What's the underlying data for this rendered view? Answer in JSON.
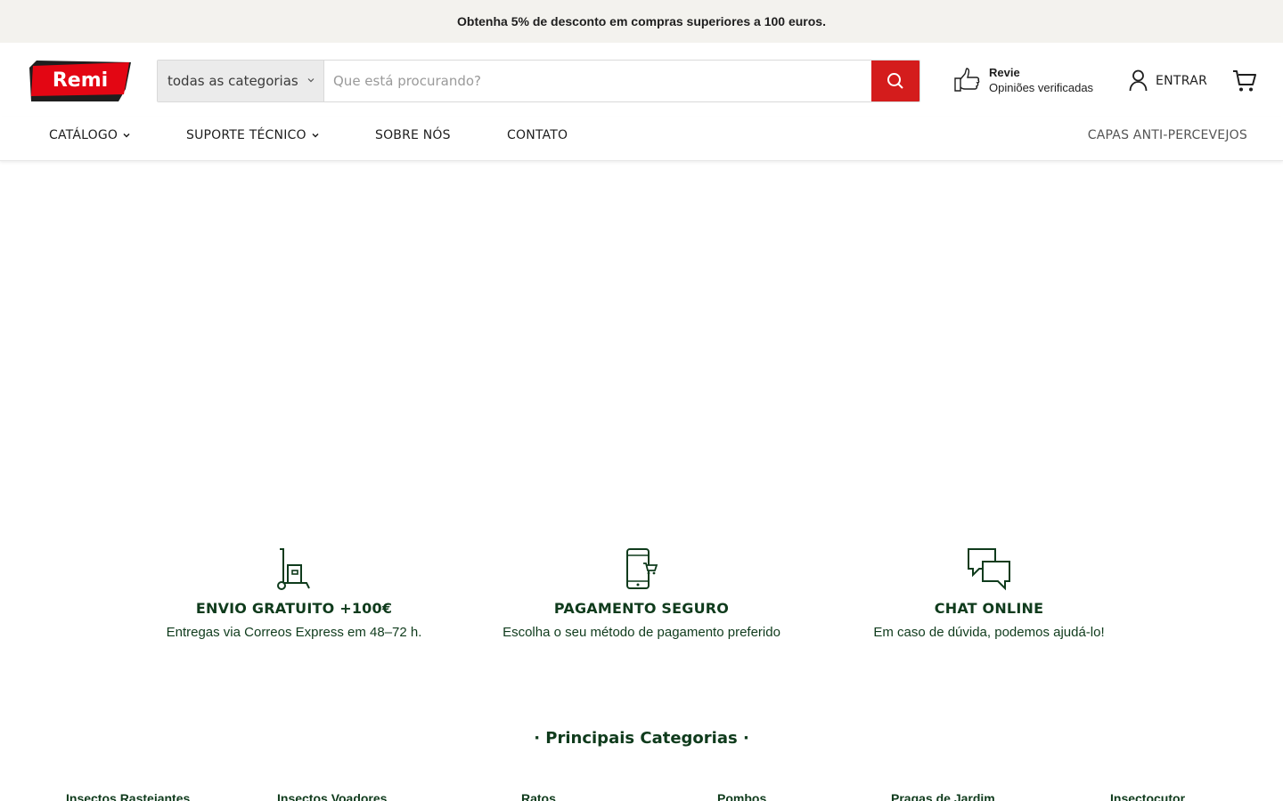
{
  "announcement": "Obtenha 5% de desconto em compras superiores a 100 euros.",
  "logo": {
    "text": "Remi",
    "color": "#e30613"
  },
  "search": {
    "category": "todas as categorias",
    "placeholder": "Que está procurando?",
    "button_color": "#d41c1c"
  },
  "reviews": {
    "title": "Revie",
    "subtitle": "Opiniões verificadas"
  },
  "account": {
    "login_label": "ENTRAR"
  },
  "nav": {
    "items": [
      {
        "label": "CATÁLOGO",
        "has_dropdown": true
      },
      {
        "label": "SUPORTE TÉCNICO",
        "has_dropdown": true
      },
      {
        "label": "SOBRE NÓS",
        "has_dropdown": false
      },
      {
        "label": "CONTATO",
        "has_dropdown": false
      }
    ],
    "right_link": "CAPAS ANTI-PERCEVEJOS"
  },
  "features": [
    {
      "icon": "delivery-trolley-icon",
      "title": "ENVIO GRATUITO +100€",
      "description": "Entregas via Correos Express em 48–72 h."
    },
    {
      "icon": "mobile-payment-icon",
      "title": "PAGAMENTO SEGURO",
      "description": "Escolha o seu método de pagamento preferido"
    },
    {
      "icon": "chat-bubbles-icon",
      "title": "CHAT ONLINE",
      "description": "Em caso de dúvida, podemos ajudá-lo!"
    }
  ],
  "categories": {
    "heading": "· Principais Categorias ·",
    "items": [
      "Insectos Rastejantes",
      "Insectos Voadores",
      "Ratos",
      "Pombos",
      "Pragas de Jardim",
      "Insectocutor"
    ]
  },
  "colors": {
    "accent": "#d41c1c",
    "brand_green": "#0f3b1c",
    "announcement_bg": "#f3f2ee"
  }
}
